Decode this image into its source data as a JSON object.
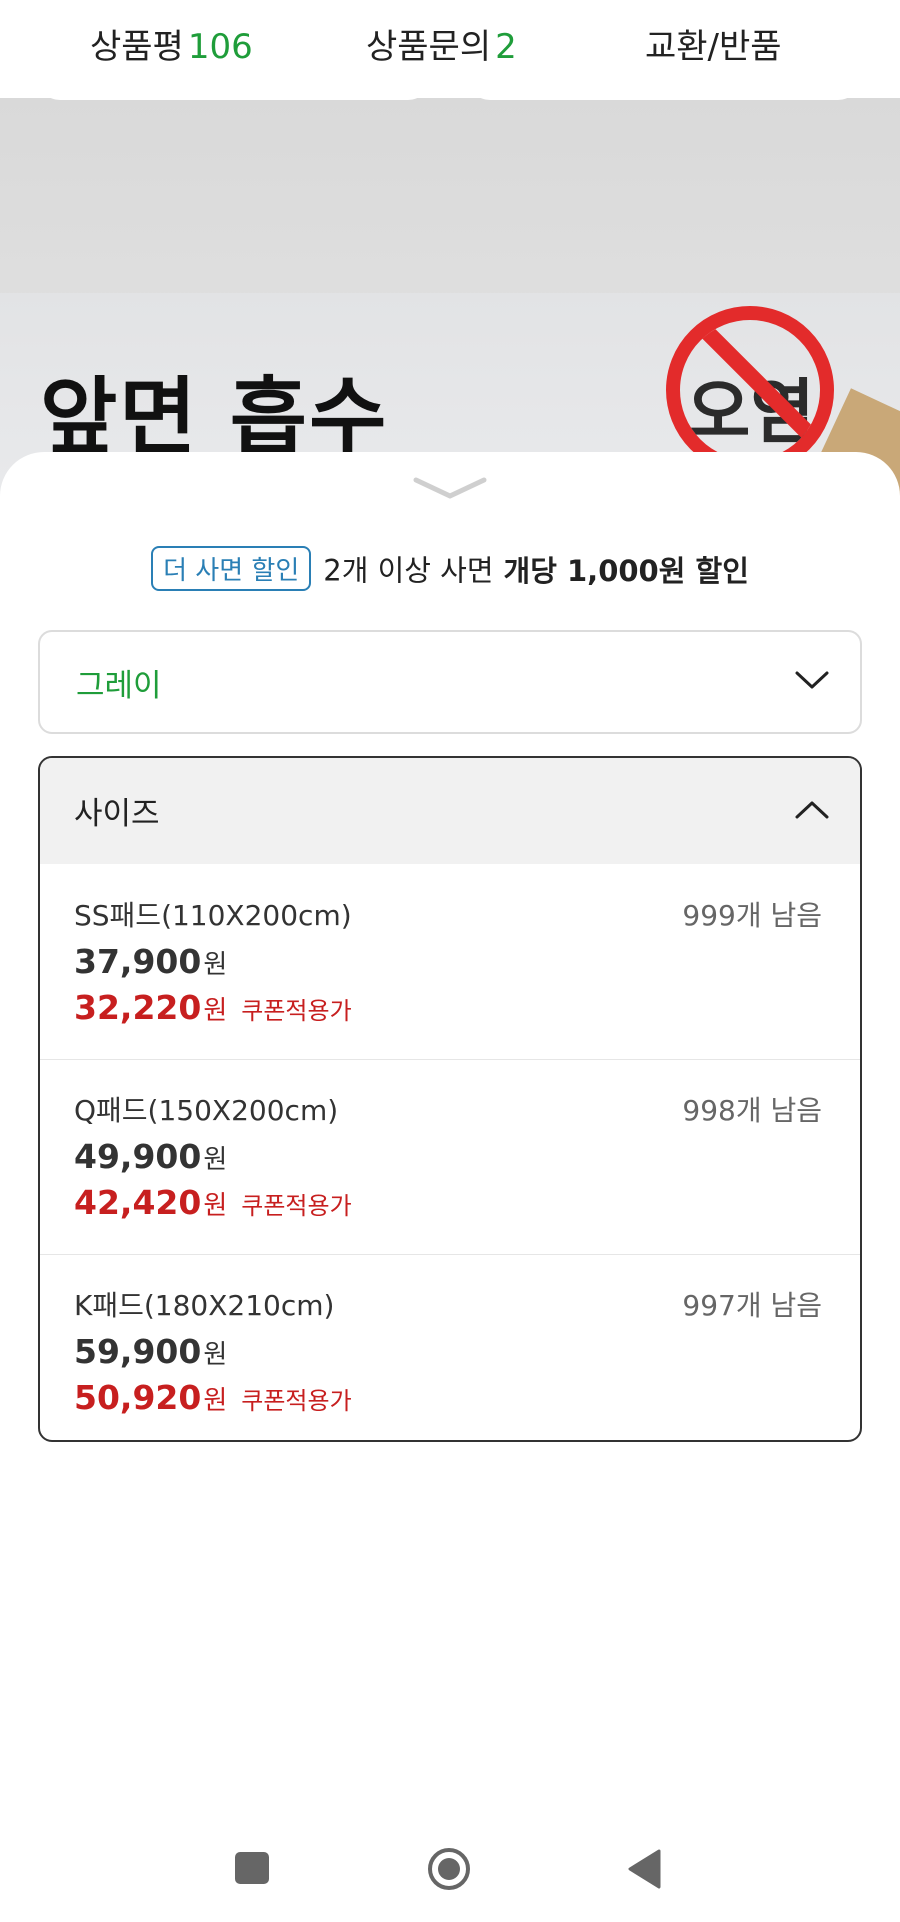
{
  "tabs": [
    {
      "label": "상품평",
      "count": "106"
    },
    {
      "label": "상품문의",
      "count": "2"
    },
    {
      "label": "교환/반품",
      "count": ""
    }
  ],
  "banner": {
    "headline": "앞면 흡수",
    "sign_text": "오염"
  },
  "sheet": {
    "discount_badge": "더 사면 할인",
    "discount_text": "2개 이상 사면",
    "discount_strong": "개당 1,000원 할인",
    "color_selected": "그레이",
    "size_label": "사이즈",
    "options": [
      {
        "name": "SS패드(110X200cm)",
        "stock": "999개 남음",
        "price": "37,900",
        "coupon_price": "32,220"
      },
      {
        "name": "Q패드(150X200cm)",
        "stock": "998개 남음",
        "price": "49,900",
        "coupon_price": "42,420"
      },
      {
        "name": "K패드(180X210cm)",
        "stock": "997개 남음",
        "price": "59,900",
        "coupon_price": "50,920"
      }
    ],
    "won": "원",
    "coupon_label": "쿠폰적용가"
  },
  "colors": {
    "accent_green": "#1f9d3a",
    "coupon_red": "#c71f1f",
    "badge_blue": "#2a7fb5",
    "no_sign_red": "#e32b2b"
  },
  "icons": {
    "handle": "chevron-down-icon",
    "color_select": "chevron-down-icon",
    "size_select": "chevron-up-icon",
    "nav": [
      "recents-square-icon",
      "home-circle-icon",
      "back-triangle-icon"
    ]
  }
}
